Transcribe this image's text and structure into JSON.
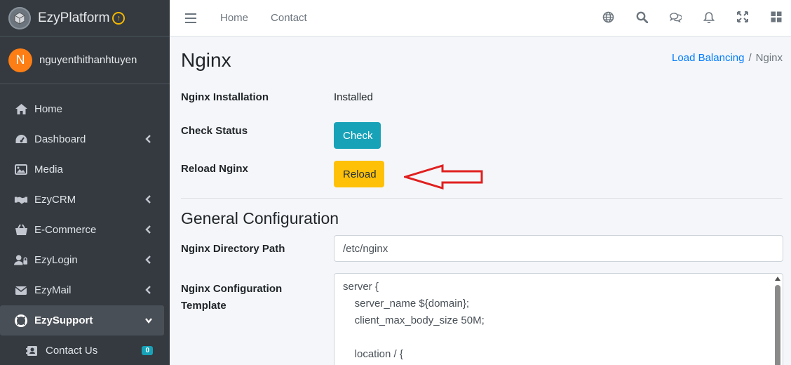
{
  "brand": {
    "name": "EzyPlatform"
  },
  "user": {
    "initial": "N",
    "name": "nguyenthithanhtuyen"
  },
  "sidebar": {
    "items": [
      {
        "label": "Home"
      },
      {
        "label": "Dashboard"
      },
      {
        "label": "Media"
      },
      {
        "label": "EzyCRM"
      },
      {
        "label": "E-Commerce"
      },
      {
        "label": "EzyLogin"
      },
      {
        "label": "EzyMail"
      },
      {
        "label": "EzySupport"
      }
    ],
    "sub_items": [
      {
        "label": "Contact Us",
        "badge": "0"
      }
    ]
  },
  "topbar": {
    "links": [
      "Home",
      "Contact"
    ]
  },
  "page": {
    "title": "Nginx",
    "breadcrumb": {
      "parent": "Load Balancing",
      "separator": "/",
      "current": "Nginx"
    }
  },
  "status": {
    "installation_label": "Nginx Installation",
    "installation_value": "Installed",
    "check_label": "Check Status",
    "check_button": "Check",
    "reload_label": "Reload Nginx",
    "reload_button": "Reload"
  },
  "config": {
    "section_title": "General Configuration",
    "directory_label": "Nginx Directory Path",
    "directory_value": "/etc/nginx",
    "template_label_line1": "Nginx Configuration",
    "template_label_line2": "Template",
    "template_lines": [
      "server {",
      "    server_name ${domain};",
      "    client_max_body_size 50M;",
      "",
      "    location / {"
    ]
  },
  "colors": {
    "sidebar_bg": "#343a40",
    "check_button": "#17a2b8",
    "reload_button": "#ffc107",
    "link": "#007bff",
    "arrow": "#e02020",
    "avatar": "#fd7e14"
  }
}
